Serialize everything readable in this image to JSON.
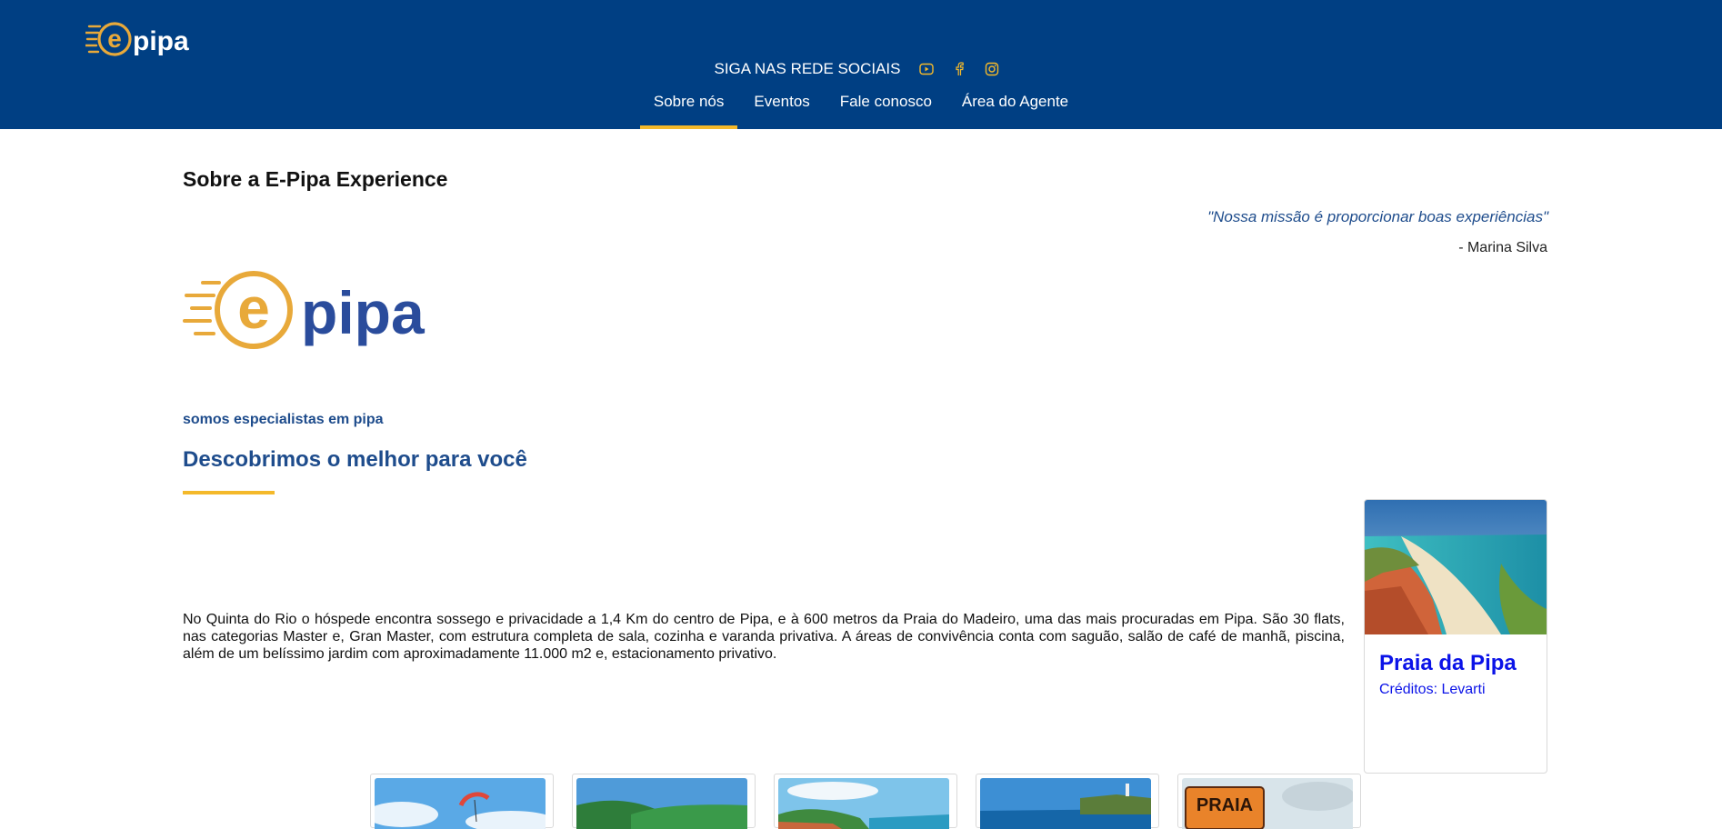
{
  "header": {
    "social_label": "SIGA NAS REDE SOCIAIS",
    "social_icons": [
      "youtube-icon",
      "facebook-icon",
      "instagram-icon"
    ],
    "nav": [
      {
        "label": "Sobre nós",
        "active": true
      },
      {
        "label": "Eventos",
        "active": false
      },
      {
        "label": "Fale conosco",
        "active": false
      },
      {
        "label": "Área do Agente",
        "active": false
      }
    ]
  },
  "logo": {
    "text": "epipa"
  },
  "main": {
    "title": "Sobre a E-Pipa Experience",
    "quote": "\"Nossa missão é proporcionar boas experiências\"",
    "quote_author": "- Marina Silva",
    "subtitle": "somos especialistas em pipa",
    "headline": "Descobrimos o melhor para você",
    "body": "No Quinta do Rio o hóspede encontra sossego e privacidade a 1,4 Km do centro de Pipa, e à 600 metros da Praia do Madeiro, uma das mais procuradas em Pipa. São 30 flats, nas categorias Master e, Gran Master, com estrutura completa de sala, cozinha e varanda privativa. A áreas de convivência conta com saguão, salão de café de manhã, piscina, além de um belíssimo jardim com aproximadamente 11.000 m2 e, estacionamento privativo."
  },
  "card": {
    "title": "Praia da Pipa",
    "credit": "Créditos: Levarti"
  },
  "gallery": {
    "sign_text": "PRAIA"
  },
  "colors": {
    "header_bg": "#003f83",
    "accent_yellow": "#f4b92a",
    "brand_orange": "#e8a93a",
    "brand_blue": "#2a4c9c",
    "text_blue": "#1e4c8c",
    "link_blue": "#0b13e8"
  }
}
